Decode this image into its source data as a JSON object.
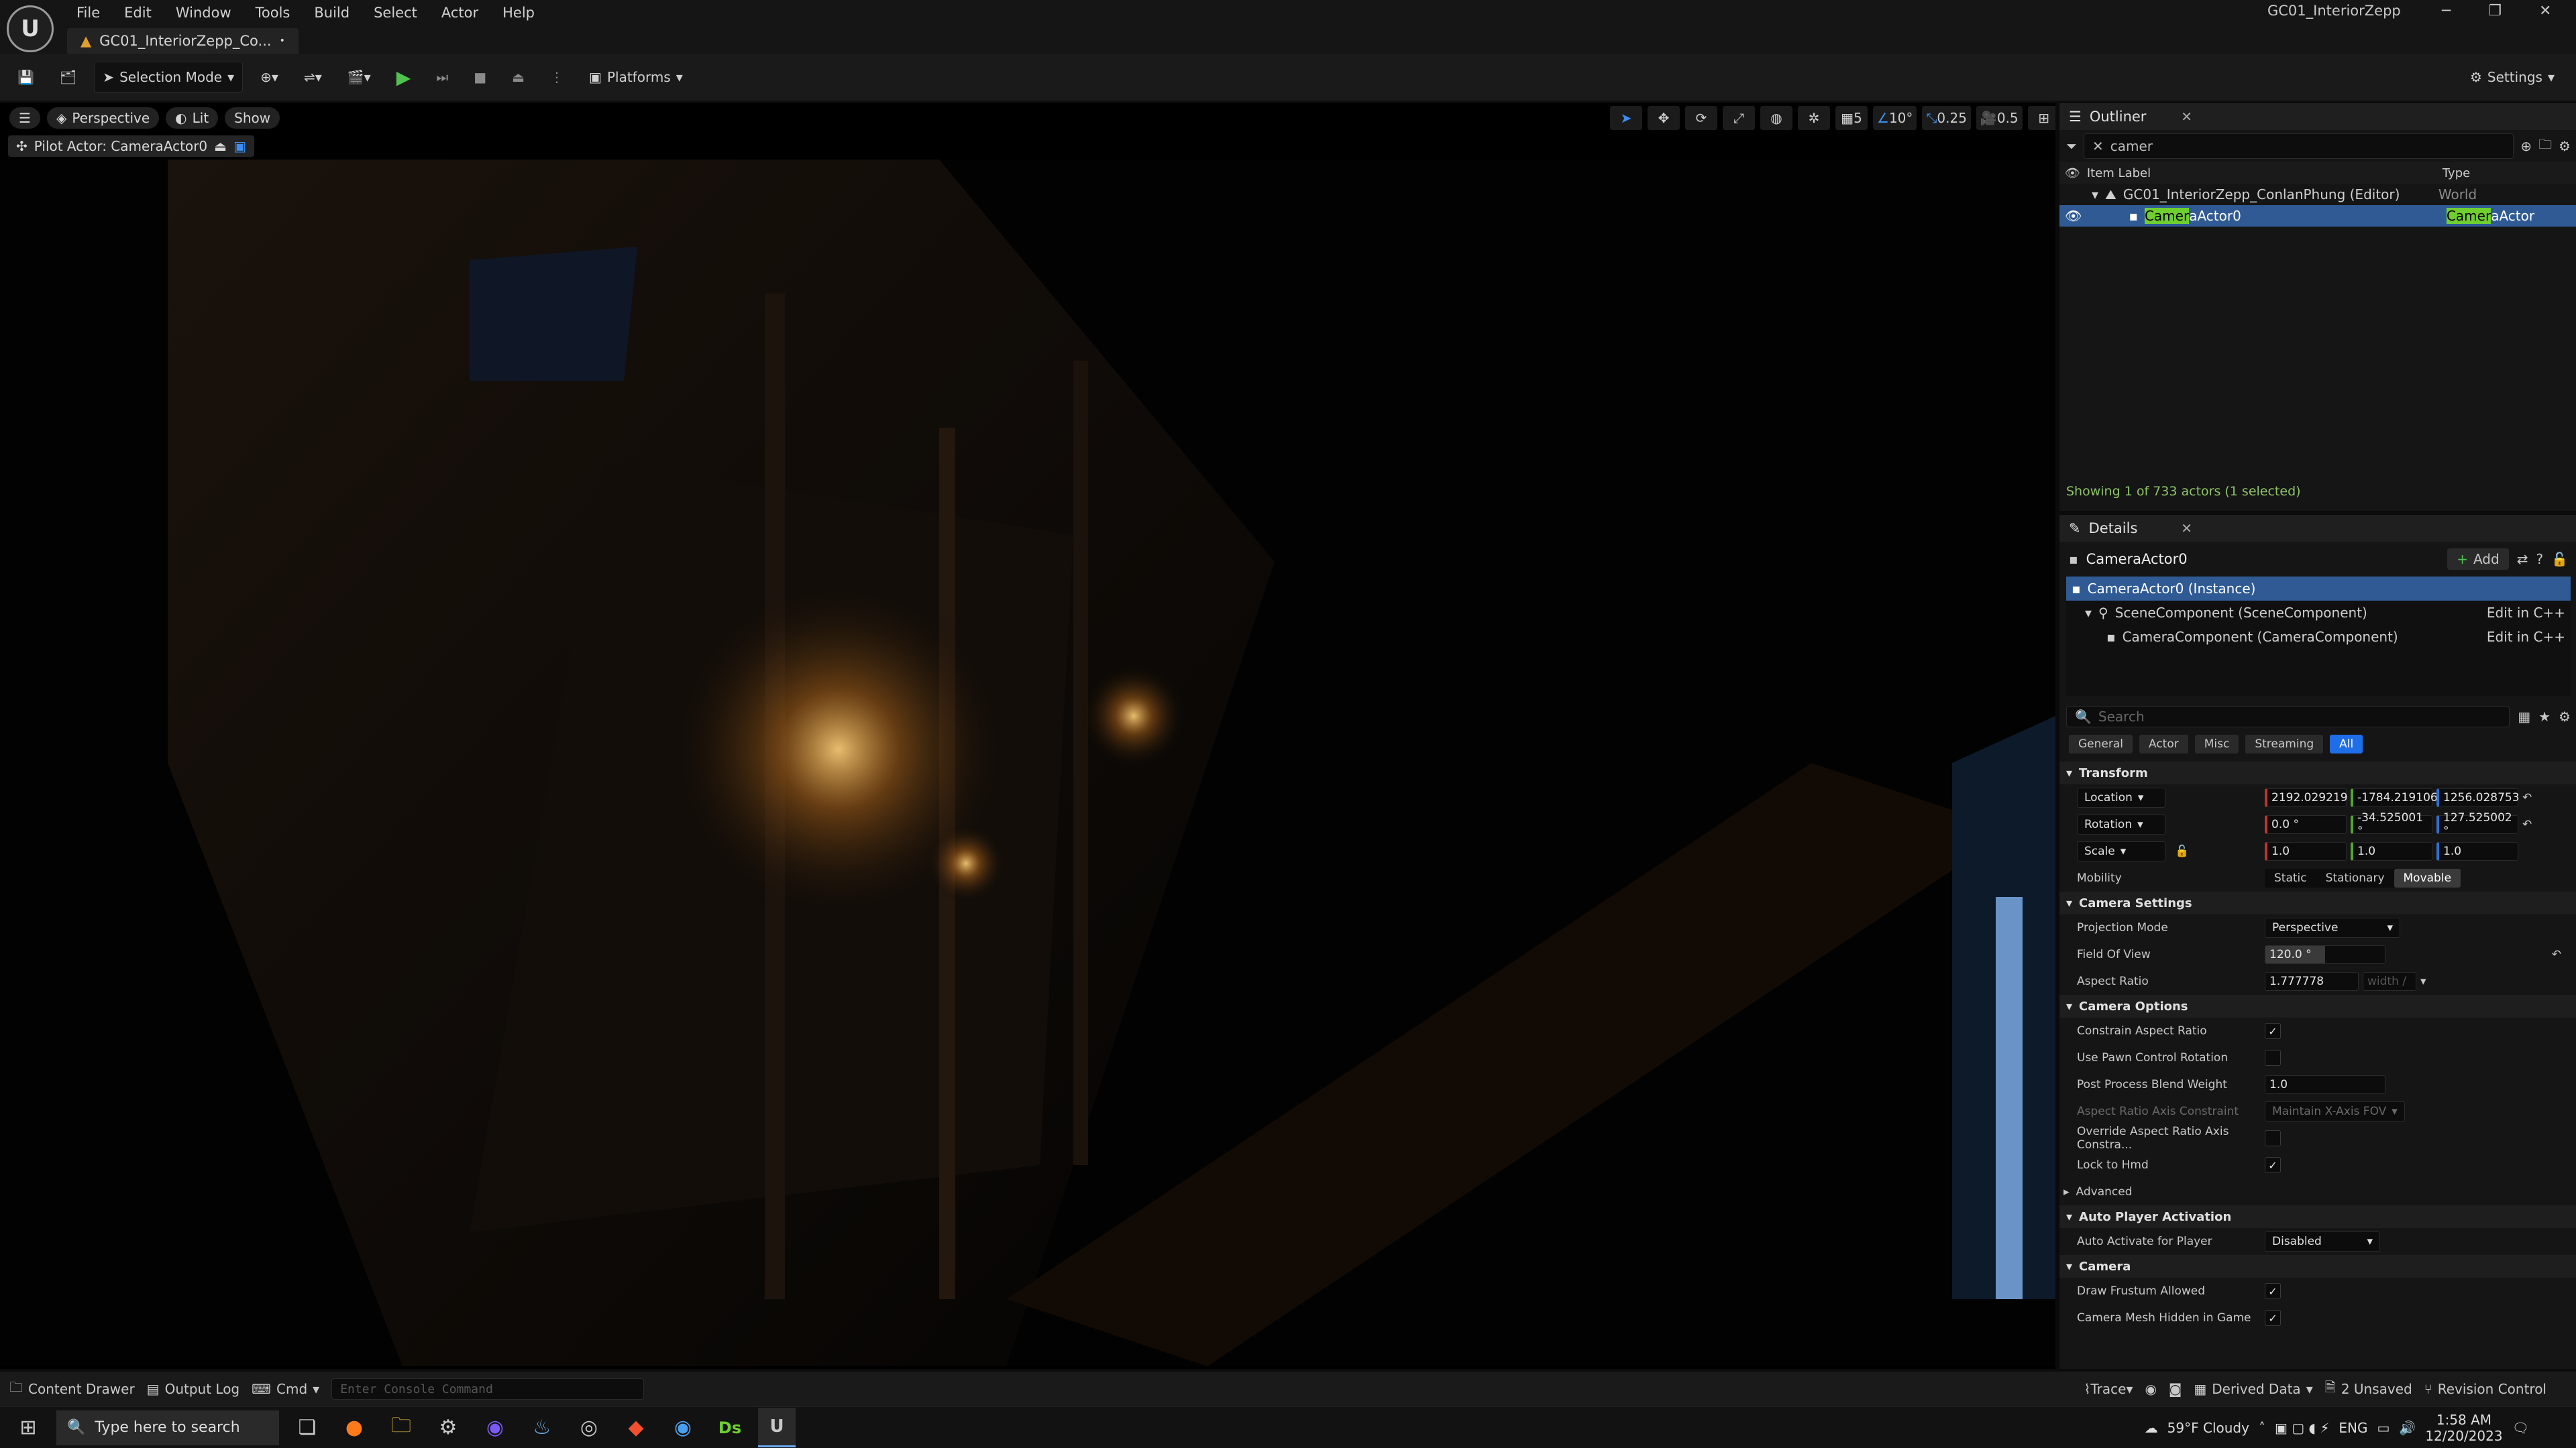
{
  "app": {
    "window_title": "GC01_InteriorZepp",
    "doc_tab": "GC01_InteriorZepp_Co...",
    "menus": [
      "File",
      "Edit",
      "Window",
      "Tools",
      "Build",
      "Select",
      "Actor",
      "Help"
    ]
  },
  "toolbar": {
    "selection_mode": "Selection Mode",
    "platforms": "Platforms",
    "settings": "Settings"
  },
  "viewport": {
    "perspective": "Perspective",
    "lit": "Lit",
    "show": "Show",
    "pilot_actor": "Pilot Actor: CameraActor0",
    "grid_value": "5",
    "angle_value": "10°",
    "scale_value": "0.25",
    "camera_speed": "0.5"
  },
  "outliner": {
    "tab": "Outliner",
    "search_value": "camer",
    "col_label": "Item Label",
    "col_type": "Type",
    "rows": [
      {
        "label": "GC01_InteriorZepp_ConlanPhung (Editor)",
        "type": "World"
      },
      {
        "label_hl": "Camer",
        "label_rest": "aActor0",
        "type_hl": "Camer",
        "type_rest": "aActor"
      }
    ],
    "status": "Showing 1 of 733 actors (1 selected)"
  },
  "details": {
    "tab": "Details",
    "actor_name": "CameraActor0",
    "add_label": "Add",
    "components": [
      {
        "label": "CameraActor0 (Instance)",
        "edit": ""
      },
      {
        "label": "SceneComponent (SceneComponent)",
        "edit": "Edit in C++"
      },
      {
        "label": "CameraComponent (CameraComponent)",
        "edit": "Edit in C++"
      }
    ],
    "search_placeholder": "Search",
    "filters": [
      "General",
      "Actor",
      "Misc",
      "Streaming",
      "All"
    ],
    "transform": {
      "title": "Transform",
      "location_label": "Location",
      "location": [
        "2192.029219",
        "-1784.219106",
        "1256.028753"
      ],
      "rotation_label": "Rotation",
      "rotation": [
        "0.0 °",
        "-34.525001 °",
        "127.525002 °"
      ],
      "scale_label": "Scale",
      "scale": [
        "1.0",
        "1.0",
        "1.0"
      ],
      "mobility_label": "Mobility",
      "mobility": [
        "Static",
        "Stationary",
        "Movable"
      ]
    },
    "camera_settings": {
      "title": "Camera Settings",
      "projection_label": "Projection Mode",
      "projection": "Perspective",
      "fov_label": "Field Of View",
      "fov": "120.0 °",
      "fov_fraction": 0.5,
      "aspect_label": "Aspect Ratio",
      "aspect": "1.777778",
      "aspect_placeholder": "width /"
    },
    "camera_options": {
      "title": "Camera Options",
      "constrain": "Constrain Aspect Ratio",
      "pawn_rotation": "Use Pawn Control Rotation",
      "pp_blend": "Post Process Blend Weight",
      "pp_blend_value": "1.0",
      "axis_constraint": "Aspect Ratio Axis Constraint",
      "axis_constraint_value": "Maintain X-Axis FOV",
      "override_axis": "Override Aspect Ratio Axis Constra...",
      "lock_hmd": "Lock to Hmd",
      "advanced": "Advanced"
    },
    "auto_player": {
      "title": "Auto Player Activation",
      "auto_activate": "Auto Activate for Player",
      "auto_activate_value": "Disabled"
    },
    "camera": {
      "title": "Camera",
      "frustum": "Draw Frustum Allowed",
      "mesh_hidden": "Camera Mesh Hidden in Game"
    }
  },
  "statusbar": {
    "content_drawer": "Content Drawer",
    "output_log": "Output Log",
    "cmd": "Cmd",
    "console_placeholder": "Enter Console Command",
    "trace": "Trace",
    "derived_data": "Derived Data",
    "unsaved": "2 Unsaved",
    "revision_control": "Revision Control"
  },
  "taskbar": {
    "search_placeholder": "Type here to search",
    "weather": "59°F Cloudy",
    "lang": "ENG",
    "time": "1:58 AM",
    "date": "12/20/2023",
    "ds_label": "Ds",
    "ue_letter": "U"
  },
  "colors": {
    "accent": "#1e6ee8",
    "selection": "#2f5a93",
    "search_highlight": "#6fcf30",
    "play": "#4fc24f"
  }
}
